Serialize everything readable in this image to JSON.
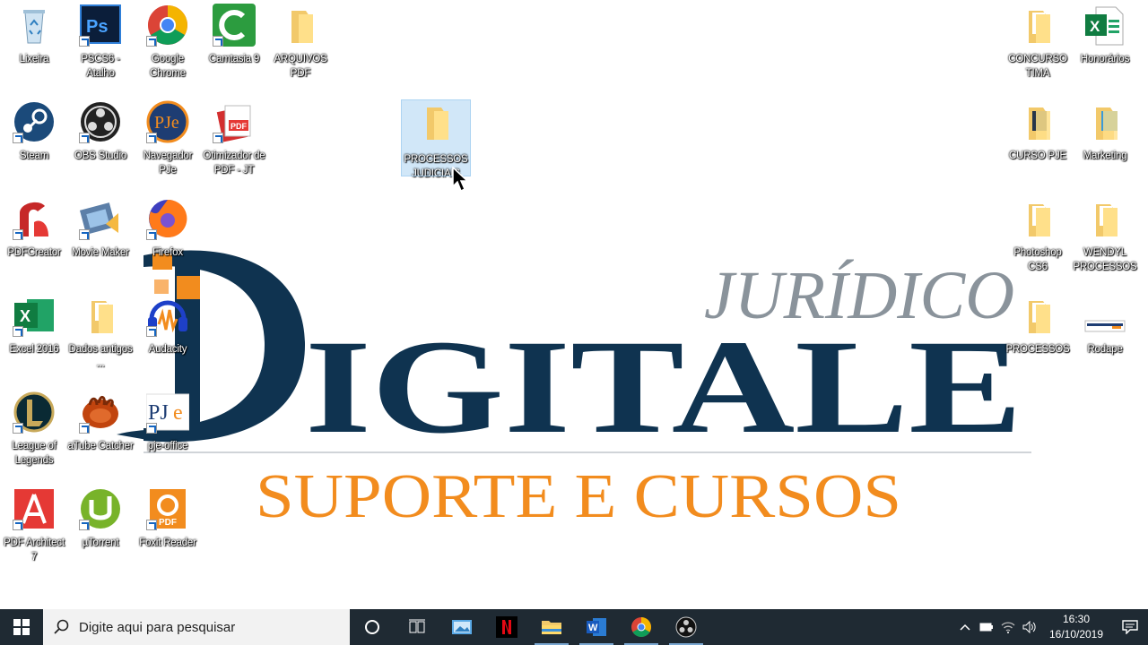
{
  "wallpaper": {
    "line1": "JURÍDICO",
    "line2": "DIGITALE",
    "line3": "SUPORTE E CURSOS",
    "colors": {
      "navy": "#0f3350",
      "gray": "#8a939b",
      "orange": "#f28c1e"
    }
  },
  "desktop": {
    "icons": [
      {
        "label": "Lixeira",
        "icon": "recycle-bin-icon"
      },
      {
        "label": "PSCS6 - Atalho",
        "icon": "photoshop-icon"
      },
      {
        "label": "Google Chrome",
        "icon": "chrome-icon"
      },
      {
        "label": "Camtasia 9",
        "icon": "camtasia-icon"
      },
      {
        "label": "ARQUIVOS PDF",
        "icon": "folder-icon"
      },
      {
        "label": "Steam",
        "icon": "steam-icon"
      },
      {
        "label": "OBS Studio",
        "icon": "obs-icon"
      },
      {
        "label": "Navegador PJe",
        "icon": "pje-icon"
      },
      {
        "label": "Otimizador de PDF - JT",
        "icon": "pdf-optimizer-icon"
      },
      {
        "label": "PROCESSOS JUDICIAIS",
        "icon": "folder-icon"
      },
      {
        "label": "PDFCreator",
        "icon": "pdfcreator-icon"
      },
      {
        "label": "Movie Maker",
        "icon": "movie-maker-icon"
      },
      {
        "label": "Firefox",
        "icon": "firefox-icon"
      },
      {
        "label": "Excel 2016",
        "icon": "excel-icon"
      },
      {
        "label": "Dados antigos ...",
        "icon": "folder-icon"
      },
      {
        "label": "Audacity",
        "icon": "audacity-icon"
      },
      {
        "label": "League of Legends",
        "icon": "league-icon"
      },
      {
        "label": "aTube Catcher",
        "icon": "atube-icon"
      },
      {
        "label": "pje-office",
        "icon": "pje-office-icon"
      },
      {
        "label": "PDF Architect 7",
        "icon": "pdf-architect-icon"
      },
      {
        "label": "µTorrent",
        "icon": "utorrent-icon"
      },
      {
        "label": "Foxit Reader",
        "icon": "foxit-icon"
      },
      {
        "label": "CONCURSO TIMA",
        "icon": "folder-icon"
      },
      {
        "label": "Honorários",
        "icon": "excel-icon"
      },
      {
        "label": "CURSO PJE",
        "icon": "folder-icon"
      },
      {
        "label": "Marketing",
        "icon": "folder-icon"
      },
      {
        "label": "Photoshop CS6",
        "icon": "folder-icon"
      },
      {
        "label": "WENDYL PROCESSOS",
        "icon": "folder-icon"
      },
      {
        "label": "PROCESSOS",
        "icon": "folder-icon"
      },
      {
        "label": "Rodape",
        "icon": "image-file-icon"
      }
    ],
    "selected": "PROCESSOS JUDICIAIS"
  },
  "taskbar": {
    "search_placeholder": "Digite aqui para pesquisar",
    "apps": [
      "cortana-icon",
      "task-view-icon",
      "photos-icon",
      "netflix-icon",
      "file-explorer-icon",
      "word-icon",
      "chrome-icon",
      "obs-icon"
    ],
    "clock": {
      "time": "16:30",
      "date": "16/10/2019"
    }
  }
}
